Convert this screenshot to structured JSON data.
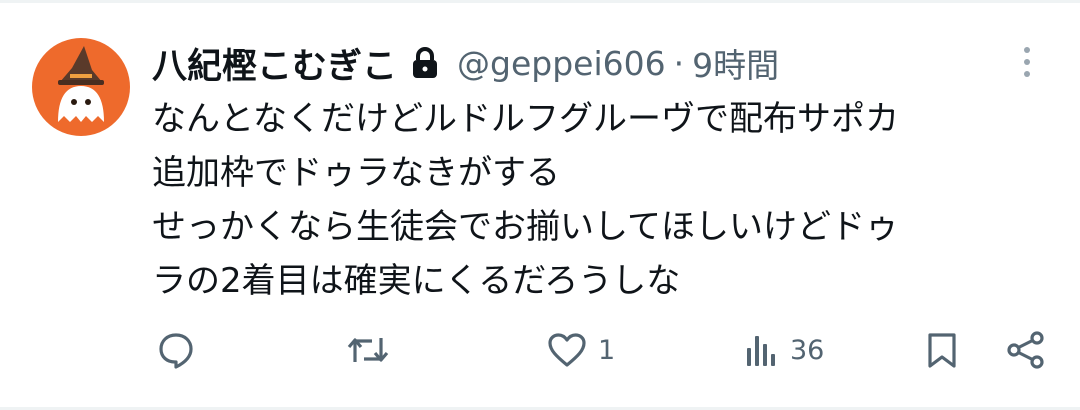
{
  "user": {
    "display_name": "八紀樫こむぎこ",
    "handle": "@geppei606",
    "separator": "·",
    "timestamp": "9時間",
    "protected": true,
    "avatar_color": "#ee6a2c"
  },
  "tweet": {
    "lines": [
      "なんとなくだけどルドルフグルーヴで配布サポカ",
      "追加枠でドゥラなきがする",
      "せっかくなら生徒会でお揃いしてほしいけどドゥ",
      "ラの2着目は確実にくるだろうしな"
    ]
  },
  "actions": {
    "reply": {
      "icon": "reply-icon",
      "count": ""
    },
    "retweet": {
      "icon": "retweet-icon",
      "count": ""
    },
    "like": {
      "icon": "heart-icon",
      "count": "1"
    },
    "views": {
      "icon": "views-icon",
      "count": "36"
    },
    "bookmark": {
      "icon": "bookmark-icon"
    },
    "share": {
      "icon": "share-icon"
    }
  },
  "colors": {
    "text_primary": "#0f1419",
    "text_secondary": "#536471",
    "icon": "#536471",
    "avatar_bg": "#ee6a2c"
  }
}
